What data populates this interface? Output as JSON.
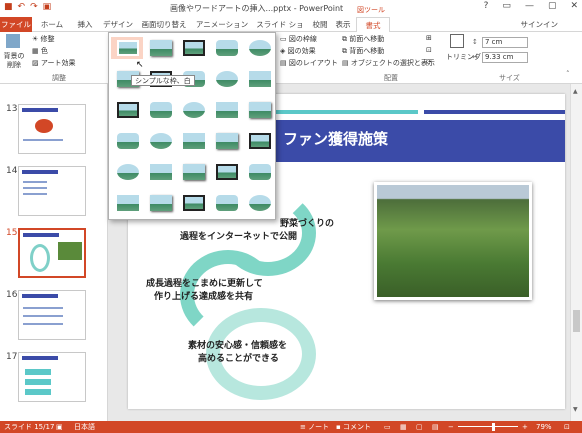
{
  "window": {
    "title": "画像やワードアートの挿入...pptx - PowerPoint",
    "context_tab_group": "図ツール",
    "signin": "サインイン",
    "controls": [
      "?",
      "▭",
      "—",
      "▢",
      "✕"
    ]
  },
  "qat": [
    "save-icon",
    "undo-icon",
    "redo-icon",
    "start-from-beginning-icon"
  ],
  "tabs": [
    {
      "label": "ファイル",
      "state": "file"
    },
    {
      "label": "ホーム",
      "state": ""
    },
    {
      "label": "挿入",
      "state": ""
    },
    {
      "label": "デザイン",
      "state": ""
    },
    {
      "label": "画面切り替え",
      "state": ""
    },
    {
      "label": "アニメーション",
      "state": ""
    },
    {
      "label": "スライド ショー",
      "state": ""
    },
    {
      "label": "校閲",
      "state": ""
    },
    {
      "label": "表示",
      "state": ""
    },
    {
      "label": "書式",
      "state": "active"
    }
  ],
  "ribbon": {
    "remove_bg": "背景の削除",
    "adjust_label": "調整",
    "adjust_items": [
      "修整",
      "色",
      "アート効果"
    ],
    "picture_border": "図の枠線",
    "picture_effects": "図の効果",
    "picture_layout": "図のレイアウト",
    "arrange_label": "配置",
    "bring_forward": "前面へ移動",
    "send_backward": "背面へ移動",
    "selection_pane": "オブジェクトの選択と表示",
    "size_label": "サイズ",
    "crop": "トリミング",
    "height": "7 cm",
    "width": "9.33 cm"
  },
  "gallery": {
    "tooltip": "シンプルな枠、白",
    "rows": 6,
    "cols": 5
  },
  "slides": [
    {
      "num": "13",
      "selected": false
    },
    {
      "num": "14",
      "selected": false
    },
    {
      "num": "15",
      "selected": true
    },
    {
      "num": "16",
      "selected": false
    },
    {
      "num": "17",
      "selected": false
    }
  ],
  "slide": {
    "title": "ファン獲得施策",
    "cycle": [
      "野菜づくりの",
      "過程をインターネットで公開",
      "成長過程をこまめに更新して",
      "作り上げる達成感を共有",
      "素材の安心感・信頼感を",
      "高めることができる"
    ]
  },
  "status": {
    "slide_pos": "スライド 15/17",
    "language": "日本語",
    "notes": "ノート",
    "comments": "コメント",
    "zoom": "79%"
  },
  "colors": {
    "accent": "#d24726",
    "header_blue": "#3b4ba8",
    "teal": "#5bc8c8"
  }
}
